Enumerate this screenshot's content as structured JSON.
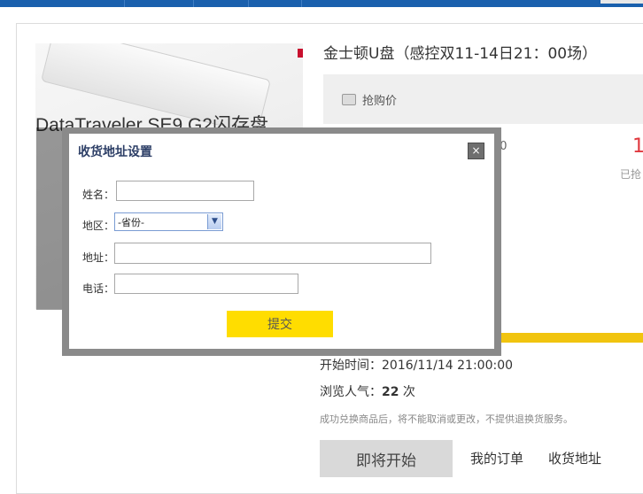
{
  "product": {
    "image_title": "DataTraveler SE9 G2闪存盘",
    "title": "金士顿U盘（感控双11-14日21：00场）",
    "price_label": "抢购价",
    "partial_date": "00",
    "partial_count": "1",
    "partial_sold": "已抢"
  },
  "info": {
    "start_time": "开始时间：2016/11/14 21:00:00",
    "views_label": "浏览人气：",
    "views_count": "22",
    "views_unit": " 次",
    "notice": "成功兑换商品后，将不能取消或更改，不提供退换货服务。"
  },
  "progress": {
    "percent": 100,
    "color": "#f1c40f"
  },
  "actions": {
    "start_button": "即将开始",
    "orders_link": "我的订单",
    "address_link": "收货地址"
  },
  "modal": {
    "title": "收货地址设置",
    "close_icon": "×",
    "name_label": "姓名：",
    "name_value": "",
    "region_label": "地区：",
    "region_selected": "-省份-",
    "address_label": "地址：",
    "address_value": "",
    "phone_label": "电话：",
    "phone_value": "",
    "submit": "提交"
  },
  "colors": {
    "topbar": "#1a60ad",
    "accent_yellow": "#ffdd00",
    "price_red": "#e0383e"
  }
}
